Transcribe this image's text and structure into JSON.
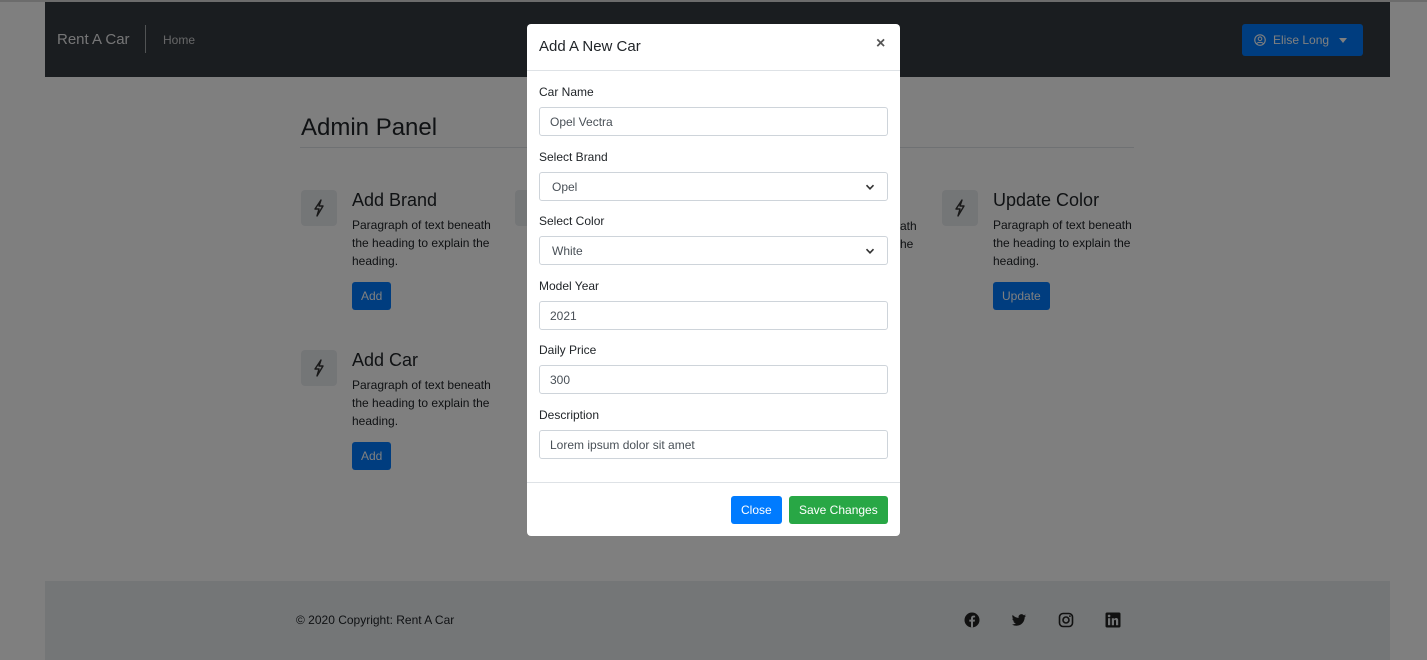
{
  "navbar": {
    "brand": "Rent A Car",
    "home_link": "Home",
    "user_name": "Elise Long"
  },
  "main": {
    "title": "Admin Panel",
    "features": [
      {
        "heading": "Add Brand",
        "text": "Paragraph of text beneath the heading to explain the heading.",
        "button": "Add"
      },
      {
        "heading": "Update Color",
        "text": "Paragraph of text beneath the heading to explain the heading.",
        "button": "Update"
      },
      {
        "heading": "Add Car",
        "text": "Paragraph of text beneath the heading to explain the heading.",
        "button": "Add"
      }
    ],
    "partial_text_1": "ath",
    "partial_text_2": "he"
  },
  "footer": {
    "copyright": "© 2020 Copyright: Rent A Car",
    "social_icons": [
      "facebook-icon",
      "twitter-icon",
      "instagram-icon",
      "linkedin-icon"
    ]
  },
  "modal": {
    "title": "Add A New Car",
    "close_symbol": "×",
    "fields": {
      "car_name": {
        "label": "Car Name",
        "value": "Opel Vectra"
      },
      "brand": {
        "label": "Select Brand",
        "value": "Opel"
      },
      "color": {
        "label": "Select Color",
        "value": "White"
      },
      "model_year": {
        "label": "Model Year",
        "value": "2021"
      },
      "daily_price": {
        "label": "Daily Price",
        "value": "300"
      },
      "description": {
        "label": "Description",
        "value": "Lorem ipsum dolor sit amet"
      }
    },
    "close_button": "Close",
    "save_button": "Save Changes"
  },
  "colors": {
    "primary": "#007bff",
    "success": "#28a745",
    "navbar": "#343a40",
    "backdrop": "rgba(0,0,0,0.5)"
  }
}
